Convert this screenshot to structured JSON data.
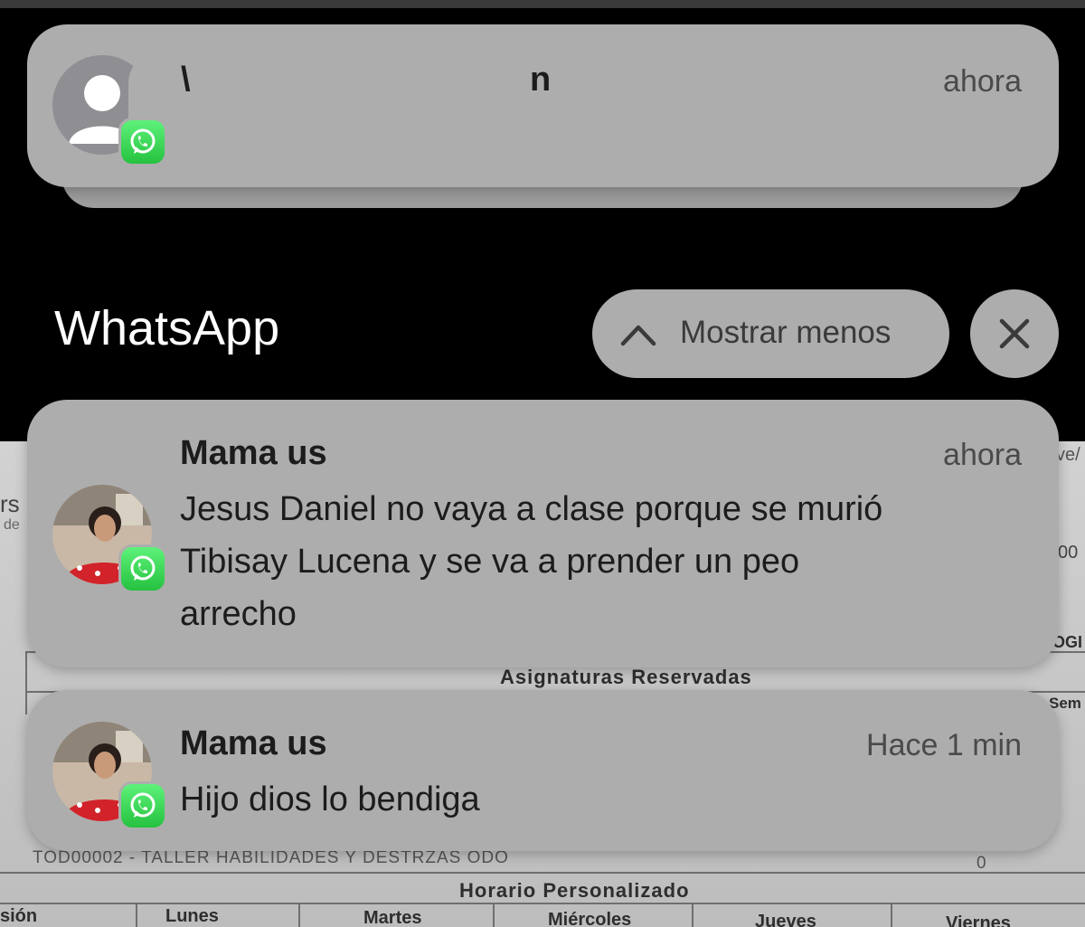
{
  "top_notification": {
    "sender_visible_1": "\\",
    "sender_visible_2": "n",
    "time": "ahora",
    "app_badge_icon": "whatsapp-icon",
    "avatar_icon": "person-placeholder-icon"
  },
  "group": {
    "title": "WhatsApp",
    "show_less_label": "Mostrar menos",
    "show_less_icon": "chevron-up-icon",
    "close_icon": "close-icon"
  },
  "notifications": [
    {
      "sender": "Mama us",
      "time": "ahora",
      "line1": "Jesus Daniel no vaya a clase porque se murió",
      "line2": "Tibisay Lucena y se va a prender un peo",
      "line3": "arrecho"
    },
    {
      "sender": "Mama us",
      "time": "Hace 1 min",
      "line1": "Hijo dios lo bendiga"
    }
  ],
  "background_document": {
    "edge_left_1": "rs",
    "edge_left_2": "de",
    "edge_right_1": "ve/",
    "edge_right_2": "00",
    "edge_right_3": "OGI",
    "edge_right_4": "Sem",
    "section_reserved": "Asignaturas Reservadas",
    "course_row": "TOD00002 - TALLER HABILIDADES Y DESTRZAS ODO",
    "course_value": "0",
    "section_schedule": "Horario Personalizado",
    "days": [
      "sión",
      "Lunes",
      "Martes",
      "Miércoles",
      "Jueves",
      "Viernes"
    ]
  },
  "colors": {
    "card": "#adadad",
    "whatsapp_green": "#25c23f",
    "screen_background": "#000000"
  }
}
